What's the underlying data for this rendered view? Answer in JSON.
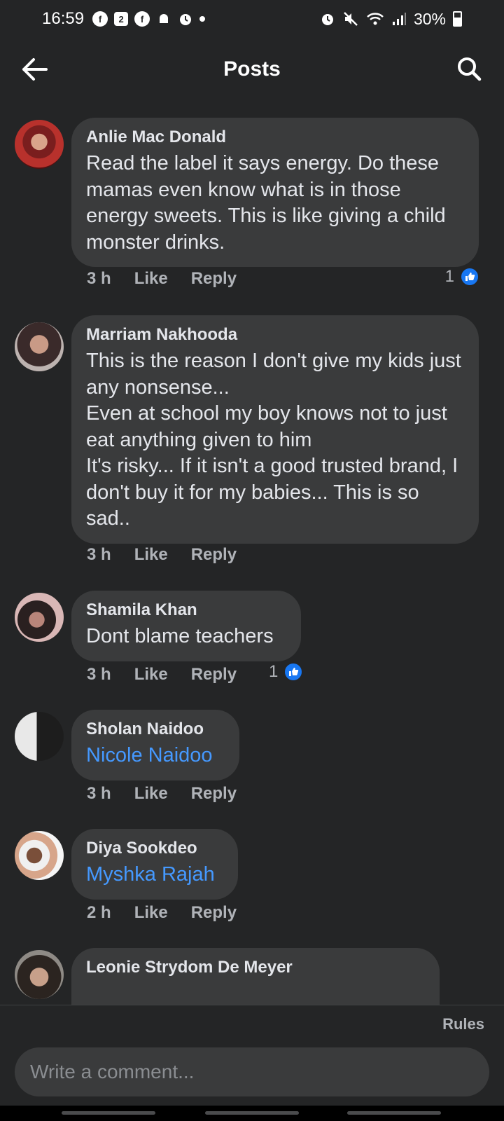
{
  "status_bar": {
    "time": "16:59",
    "battery": "30%",
    "icons_left": [
      "facebook-icon",
      "calendar-icon",
      "facebook-icon",
      "android-icon",
      "alarm-icon",
      "dot-icon"
    ],
    "calendar_day": "2",
    "icons_right": [
      "alarm-icon",
      "mute-icon",
      "wifi-icon",
      "signal-icon",
      "battery-icon"
    ]
  },
  "header": {
    "title": "Posts",
    "back_icon": "arrow-left-icon",
    "search_icon": "search-icon"
  },
  "comments": [
    {
      "author": "Anlie Mac Donald",
      "text": "Read the label it says energy. Do these mamas even know what is in those energy sweets. This is like giving a child monster drinks.",
      "time": "3 h",
      "like_label": "Like",
      "reply_label": "Reply",
      "reaction_count": "1"
    },
    {
      "author": "Marriam Nakhooda",
      "text": "This is the reason I don't give my kids just any nonsense...\nEven at school my boy knows not to just eat anything given to him\nIt's risky... If it isn't a good trusted brand, I don't buy it for my babies... This is so sad..",
      "time": "3 h",
      "like_label": "Like",
      "reply_label": "Reply"
    },
    {
      "author": "Shamila Khan",
      "text": "Dont blame teachers",
      "time": "3 h",
      "like_label": "Like",
      "reply_label": "Reply",
      "reaction_count": "1"
    },
    {
      "author": "Sholan Naidoo",
      "tagged": "Nicole Naidoo",
      "time": "3 h",
      "like_label": "Like",
      "reply_label": "Reply"
    },
    {
      "author": "Diya Sookdeo",
      "tagged": "Myshka Rajah",
      "time": "2 h",
      "like_label": "Like",
      "reply_label": "Reply"
    },
    {
      "author": "Leonie Strydom De Meyer"
    }
  ],
  "footer": {
    "rules_label": "Rules",
    "comment_placeholder": "Write a comment..."
  },
  "colors": {
    "background": "#242526",
    "bubble": "#3a3b3c",
    "link": "#4599ff",
    "like_blue": "#1877f2",
    "muted_text": "#b0b3b8"
  }
}
